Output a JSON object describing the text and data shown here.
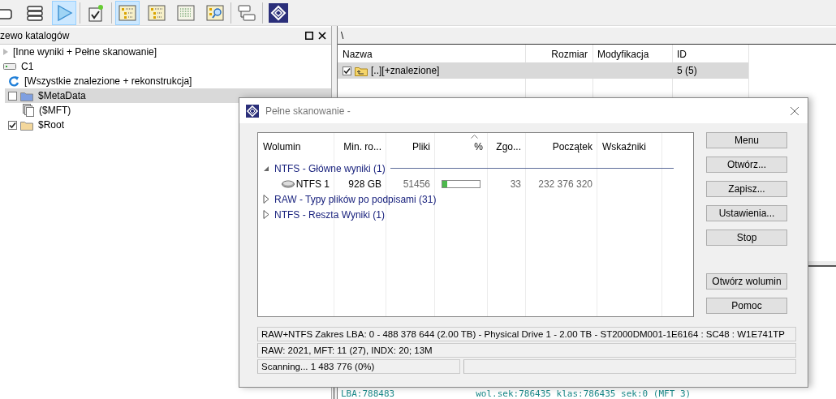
{
  "toolbar": {
    "groups": [
      [
        {
          "kind": "panel",
          "selected": false
        },
        {
          "kind": "stack",
          "selected": false
        },
        {
          "kind": "play",
          "selected": true
        }
      ],
      [
        {
          "kind": "task",
          "selected": false
        }
      ],
      [
        {
          "kind": "tree",
          "selected": true
        },
        {
          "kind": "tree",
          "selected": false
        },
        {
          "kind": "details",
          "selected": false
        },
        {
          "kind": "find",
          "selected": false
        }
      ],
      [
        {
          "kind": "layout",
          "selected": false
        }
      ],
      [
        {
          "kind": "logo",
          "selected": false
        }
      ]
    ]
  },
  "tree_panel": {
    "title": "zewo katalogów",
    "items": [
      {
        "kind": "group",
        "label": "[Inne wyniki + Pełne skanowanie]",
        "selected": false
      },
      {
        "kind": "drive",
        "label": "C1",
        "selected": false,
        "children": [
          {
            "kind": "refresh",
            "label": "[Wszystkie znalezione + rekonstrukcja]",
            "selected": false
          },
          {
            "kind": "folder",
            "label": "$MetaData",
            "checked": false,
            "color": "#7f9fe0",
            "selected": true,
            "children": [
              {
                "kind": "file",
                "label": "($MFT)",
                "selected": false
              }
            ]
          },
          {
            "kind": "folder",
            "label": "$Root",
            "checked": true,
            "color": "#f3d79c",
            "selected": false
          }
        ]
      }
    ]
  },
  "file_panel": {
    "path": "\\",
    "columns": [
      "Nazwa",
      "Rozmiar",
      "Modyfikacja",
      "ID"
    ],
    "rows": [
      {
        "name": "[..][+znalezione]",
        "id": "5 (5)",
        "checked": true,
        "selected": true
      }
    ],
    "log_line": [
      "LBA:788483",
      "wol.sek:786435 klas:786435 sek:0 (MFT 3)"
    ]
  },
  "dialog": {
    "title": "Pełne skanowanie -",
    "columns": [
      {
        "label": "Wolumin",
        "sorted": false
      },
      {
        "label": "Min. ro...",
        "sorted": false
      },
      {
        "label": "Pliki",
        "sorted": false
      },
      {
        "label": "%",
        "sorted": true
      },
      {
        "label": "Zgo...",
        "sorted": false
      },
      {
        "label": "Początek",
        "sorted": false
      },
      {
        "label": "Wskaźniki",
        "sorted": false
      }
    ],
    "groups": [
      {
        "label": "NTFS - Główne wyniki (1)",
        "expanded": true,
        "volumes": [
          {
            "name": "NTFS 1",
            "min_size": "928 GB",
            "files": "51456",
            "level": 0.12,
            "matched": "33",
            "start": "232 376 320"
          }
        ]
      },
      {
        "label": "RAW - Typy plików po podpisami (31)",
        "expanded": false
      },
      {
        "label": "NTFS - Reszta Wyniki (1)",
        "expanded": false
      }
    ],
    "buttons": [
      "Menu",
      "Otwórz...",
      "Zapisz...",
      "Ustawienia...",
      "Stop"
    ],
    "volume_buttons": [
      "Otwórz wolumin",
      "Pomoc"
    ],
    "range": "RAW+NTFS Zakres LBA: 0 - 488 378 644 (2.00 TB) - Physical Drive 1 - 2.00 TB - ST2000DM001-1E6164 : SC48 : W1E741TP",
    "stats": "RAW: 2021, MFT: 11 (27), INDX: 20; 13M",
    "progress_text": "Scanning... 1 483 776 (0%)"
  }
}
